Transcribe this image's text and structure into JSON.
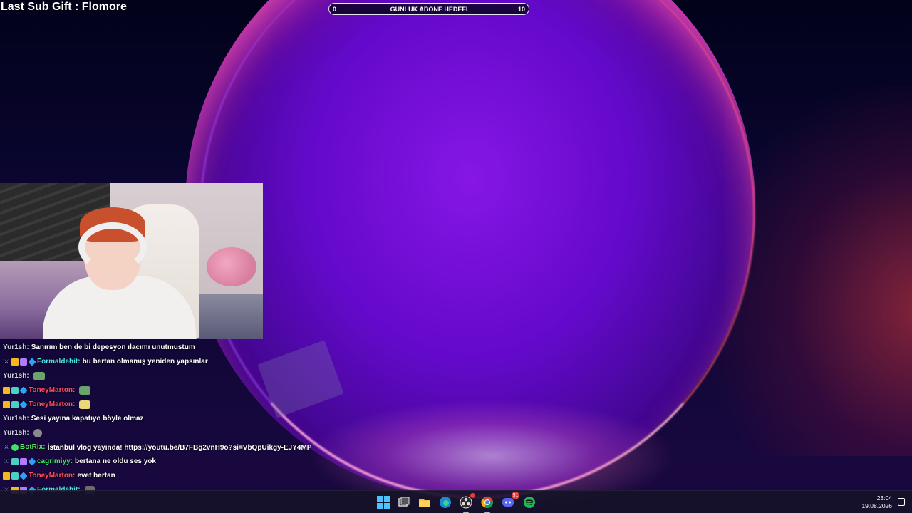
{
  "overlay": {
    "last_sub_gift": "Last Sub Gift : Flomore",
    "goal": {
      "label": "GÜNLÜK ABONE HEDEFİ",
      "current": "0",
      "target": "10",
      "progress": 0.0
    }
  },
  "chat": {
    "messages": [
      {
        "user": "Yur1sh",
        "color": "#cfcfe6",
        "badges": [],
        "text": "Sanırım ben de bi depesyon ılacımı unutmustum",
        "emote": ""
      },
      {
        "user": "Formaldehit",
        "color": "#4fe3e3",
        "badges": [
          "sword-icon",
          "crown-icon",
          "gift-icon",
          "gem-icon"
        ],
        "text": "bu bertan olmamış yeniden yapsınlar",
        "emote": ""
      },
      {
        "user": "Yur1sh",
        "color": "#cfcfe6",
        "badges": [],
        "text": "",
        "emote": "frog-emote"
      },
      {
        "user": "ToneyMarton",
        "color": "#ff4d5e",
        "badges": [
          "crown-icon",
          "grid-icon",
          "gem-icon"
        ],
        "text": "",
        "emote": "frog-emote"
      },
      {
        "user": "ToneyMarton",
        "color": "#ff4d5e",
        "badges": [
          "crown-icon",
          "grid-icon",
          "gem-icon"
        ],
        "text": "",
        "emote": "box-emote"
      },
      {
        "user": "Yur1sh",
        "color": "#cfcfe6",
        "badges": [],
        "text": "Sesi yayına kapatıyo böyle olmaz",
        "emote": ""
      },
      {
        "user": "Yur1sh",
        "color": "#cfcfe6",
        "badges": [],
        "text": "",
        "emote": "eye-emote"
      },
      {
        "user": "BotRix",
        "color": "#58f05a",
        "badges": [
          "sword-icon",
          "bot-icon"
        ],
        "text": "İstanbul vlog yayında! https://youtu.be/B7FBg2vnH9o?si=VbQpUikgy-EJY4MP",
        "emote": ""
      },
      {
        "user": "cagrimiyy",
        "color": "#3fe06a",
        "badges": [
          "sword-icon",
          "grid-icon",
          "gift-icon",
          "gem-icon"
        ],
        "text": "bertana ne oldu ses yok",
        "emote": ""
      },
      {
        "user": "ToneyMarton",
        "color": "#ff4d5e",
        "badges": [
          "crown-icon",
          "grid-icon",
          "gem-icon"
        ],
        "text": "evet bertan",
        "emote": ""
      },
      {
        "user": "Formaldehit",
        "color": "#4fe3e3",
        "badges": [
          "sword-icon",
          "crown-icon",
          "gift-icon",
          "gem-icon"
        ],
        "text": "",
        "emote": "block-emote"
      }
    ]
  },
  "taskbar": {
    "icons": [
      {
        "name": "windows-start-icon",
        "badge": ""
      },
      {
        "name": "task-view-icon",
        "badge": ""
      },
      {
        "name": "file-explorer-icon",
        "badge": ""
      },
      {
        "name": "edge-icon",
        "badge": ""
      },
      {
        "name": "obs-icon",
        "badge": ""
      },
      {
        "name": "chrome-icon",
        "badge": ""
      },
      {
        "name": "discord-icon",
        "badge": "91"
      },
      {
        "name": "spotify-icon",
        "badge": ""
      }
    ],
    "time": "23:04",
    "date": "19.08.2026"
  }
}
